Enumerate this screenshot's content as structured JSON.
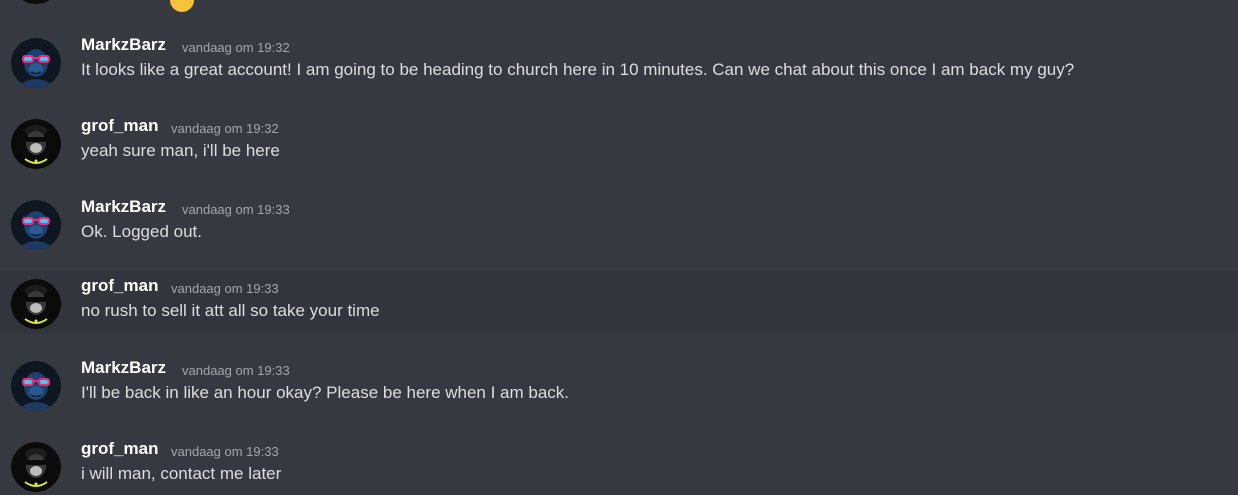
{
  "partial_message": {
    "text": "",
    "emoji": "smile-emoji"
  },
  "messages": [
    {
      "author": "MarkzBarz",
      "timestamp": "vandaag om 19:32",
      "text": "It looks like a great account! I am going to be heading to church here in 10 minutes. Can we chat about this once I am back my guy?"
    },
    {
      "author": "grof_man",
      "timestamp": "vandaag om 19:32",
      "text": "yeah sure man, i'll be here"
    },
    {
      "author": "MarkzBarz",
      "timestamp": "vandaag om 19:33",
      "text": "Ok. Logged out."
    },
    {
      "author": "grof_man",
      "timestamp": "vandaag om 19:33",
      "text": "no rush to sell it att all so take your time"
    },
    {
      "author": "MarkzBarz",
      "timestamp": "vandaag om 19:33",
      "text": "I'll be back in like an hour okay? Please be here when I am back."
    },
    {
      "author": "grof_man",
      "timestamp": "vandaag om 19:33",
      "text": "i will man, contact me later"
    }
  ],
  "colors": {
    "background": "#36393f",
    "hover_background": "#32353b",
    "username": "#ffffff",
    "text": "#dcddde",
    "timestamp": "#a3a6aa"
  }
}
